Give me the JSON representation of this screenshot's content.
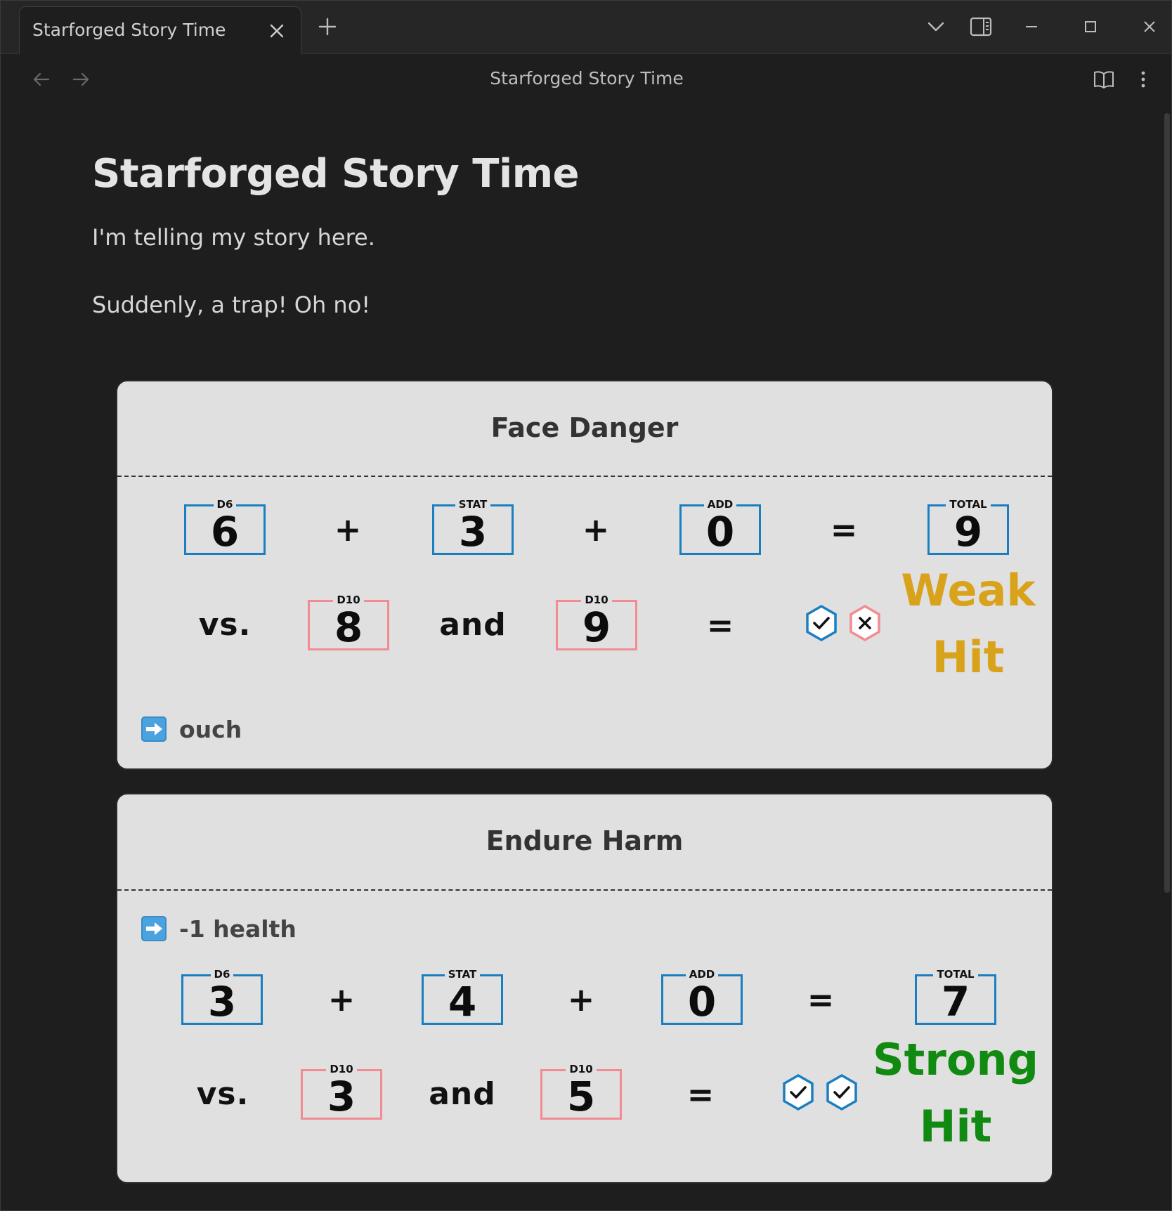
{
  "tab": {
    "title": "Starforged Story Time"
  },
  "view": {
    "title": "Starforged Story Time"
  },
  "document": {
    "title": "Starforged Story Time",
    "paragraphs": [
      "I'm telling my story here.",
      "Suddenly, a trap! Oh no!"
    ]
  },
  "colors": {
    "action_die_border": "#1a7fc1",
    "challenge_die_border": "#f28b92",
    "weak_hit": "#d9a21b",
    "strong_hit": "#118a11",
    "card_bg": "#e0e0e0"
  },
  "moves": [
    {
      "name": "Face Danger",
      "action": {
        "d6": {
          "label": "D6",
          "value": "6"
        },
        "stat": {
          "label": "STAT",
          "value": "3"
        },
        "add": {
          "label": "ADD",
          "value": "0"
        },
        "total": {
          "label": "TOTAL",
          "value": "9"
        }
      },
      "plus": "+",
      "equals": "=",
      "vs": "vs.",
      "and": "and",
      "challenge": [
        {
          "label": "D10",
          "value": "8",
          "beaten": true
        },
        {
          "label": "D10",
          "value": "9",
          "beaten": false
        }
      ],
      "outcome_line1": "Weak",
      "outcome_line2": "Hit",
      "consequence": "ouch",
      "consequence_icon": "right-arrow-emoji-icon"
    },
    {
      "name": "Endure Harm",
      "consequence": "-1 health",
      "consequence_icon": "right-arrow-emoji-icon",
      "action": {
        "d6": {
          "label": "D6",
          "value": "3"
        },
        "stat": {
          "label": "STAT",
          "value": "4"
        },
        "add": {
          "label": "ADD",
          "value": "0"
        },
        "total": {
          "label": "TOTAL",
          "value": "7"
        }
      },
      "plus": "+",
      "equals": "=",
      "vs": "vs.",
      "and": "and",
      "challenge": [
        {
          "label": "D10",
          "value": "3",
          "beaten": true
        },
        {
          "label": "D10",
          "value": "5",
          "beaten": true
        }
      ],
      "outcome_line1": "Strong",
      "outcome_line2": "Hit"
    }
  ]
}
